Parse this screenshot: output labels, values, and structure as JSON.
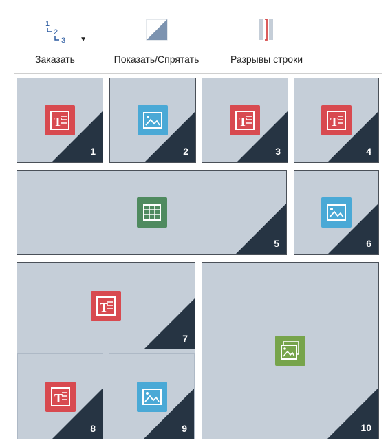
{
  "toolbar": {
    "order_label": "Заказать",
    "order_digits": [
      "1",
      "2",
      "3"
    ],
    "show_hide_label": "Показать/Спрятать",
    "line_breaks_label": "Разрывы строки"
  },
  "tiles": [
    {
      "number": "1",
      "content": "text-icon"
    },
    {
      "number": "2",
      "content": "image-icon"
    },
    {
      "number": "3",
      "content": "text-icon"
    },
    {
      "number": "4",
      "content": "text-icon"
    },
    {
      "number": "5",
      "content": "table-icon"
    },
    {
      "number": "6",
      "content": "image-icon"
    },
    {
      "number": "7",
      "content": "text-icon"
    },
    {
      "number": "8",
      "content": "text-icon"
    },
    {
      "number": "9",
      "content": "image-icon"
    },
    {
      "number": "10",
      "content": "gallery-icon"
    }
  ],
  "colors": {
    "tile_bg": "#c5ced8",
    "corner": "#263443",
    "text_icon": "#d84a50",
    "image_icon": "#4aa9d6",
    "table_icon": "#4f8a5f",
    "gallery_icon": "#77a44b"
  }
}
